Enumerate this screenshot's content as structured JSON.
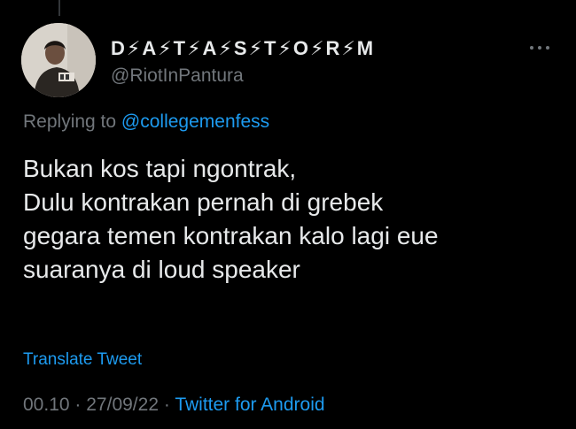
{
  "tweet": {
    "author": {
      "display_name": "D⚡A⚡T⚡A⚡S⚡T⚡O⚡R⚡M",
      "handle": "@RiotInPantura",
      "avatar_icon": "profile-photo"
    },
    "more_icon": "more-horizontal-icon",
    "replying_prefix": "Replying to",
    "replying_to": "@collegemenfess",
    "text": "Bukan kos tapi ngontrak,\nDulu kontrakan pernah di grebek\ngegara temen kontrakan kalo lagi eue\nsuaranya di loud speaker",
    "translate_label": "Translate Tweet",
    "time": "00.10",
    "date": "27/09/22",
    "separator": "·",
    "source": "Twitter for Android"
  },
  "colors": {
    "background": "#000000",
    "text_primary": "#e7e9ea",
    "text_secondary": "#71767b",
    "link": "#1d9bf0"
  }
}
